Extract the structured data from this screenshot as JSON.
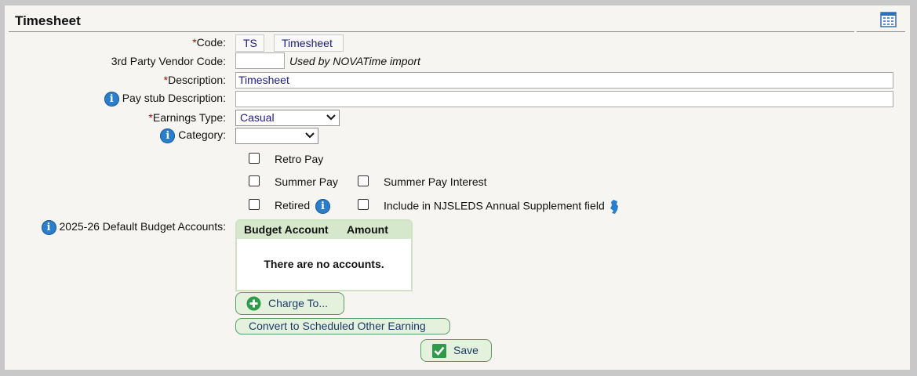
{
  "header": {
    "title": "Timesheet",
    "calendar_icon": "calendar-icon"
  },
  "form": {
    "code": {
      "label": "Code:",
      "required_mark": "*",
      "value": "TS",
      "name_value": "Timesheet"
    },
    "vendor_code": {
      "label": "3rd Party Vendor Code:",
      "value": "",
      "note": "Used by NOVATime import"
    },
    "description": {
      "label": "Description:",
      "required_mark": "*",
      "value": "Timesheet"
    },
    "pay_stub_description": {
      "label": "Pay stub Description:",
      "value": "",
      "info_icon": "info-icon"
    },
    "earnings_type": {
      "label": "Earnings Type:",
      "required_mark": "*",
      "value": "Casual"
    },
    "category": {
      "label": "Category:",
      "value": "",
      "info_icon": "info-icon"
    },
    "checkboxes": {
      "retro_pay": {
        "label": "Retro Pay",
        "checked": false
      },
      "summer_pay": {
        "label": "Summer Pay",
        "checked": false
      },
      "summer_pay_interest": {
        "label": "Summer Pay Interest",
        "checked": false
      },
      "retired": {
        "label": "Retired",
        "checked": false
      },
      "njsleds": {
        "label": "Include in NJSLEDS Annual Supplement field",
        "checked": false,
        "icon": "new-jersey-icon"
      }
    },
    "budget_accounts": {
      "label": "2025-26 Default Budget Accounts:",
      "columns": [
        "Budget Account",
        "Amount"
      ],
      "empty_text": "There are no accounts."
    }
  },
  "actions": {
    "charge_to": "Charge To...",
    "convert": "Convert to Scheduled Other Earning",
    "save": "Save"
  },
  "colors": {
    "accent_green": "#2e9a4a",
    "info_blue": "#2b7ecb",
    "value_text": "#1b1b8a"
  }
}
